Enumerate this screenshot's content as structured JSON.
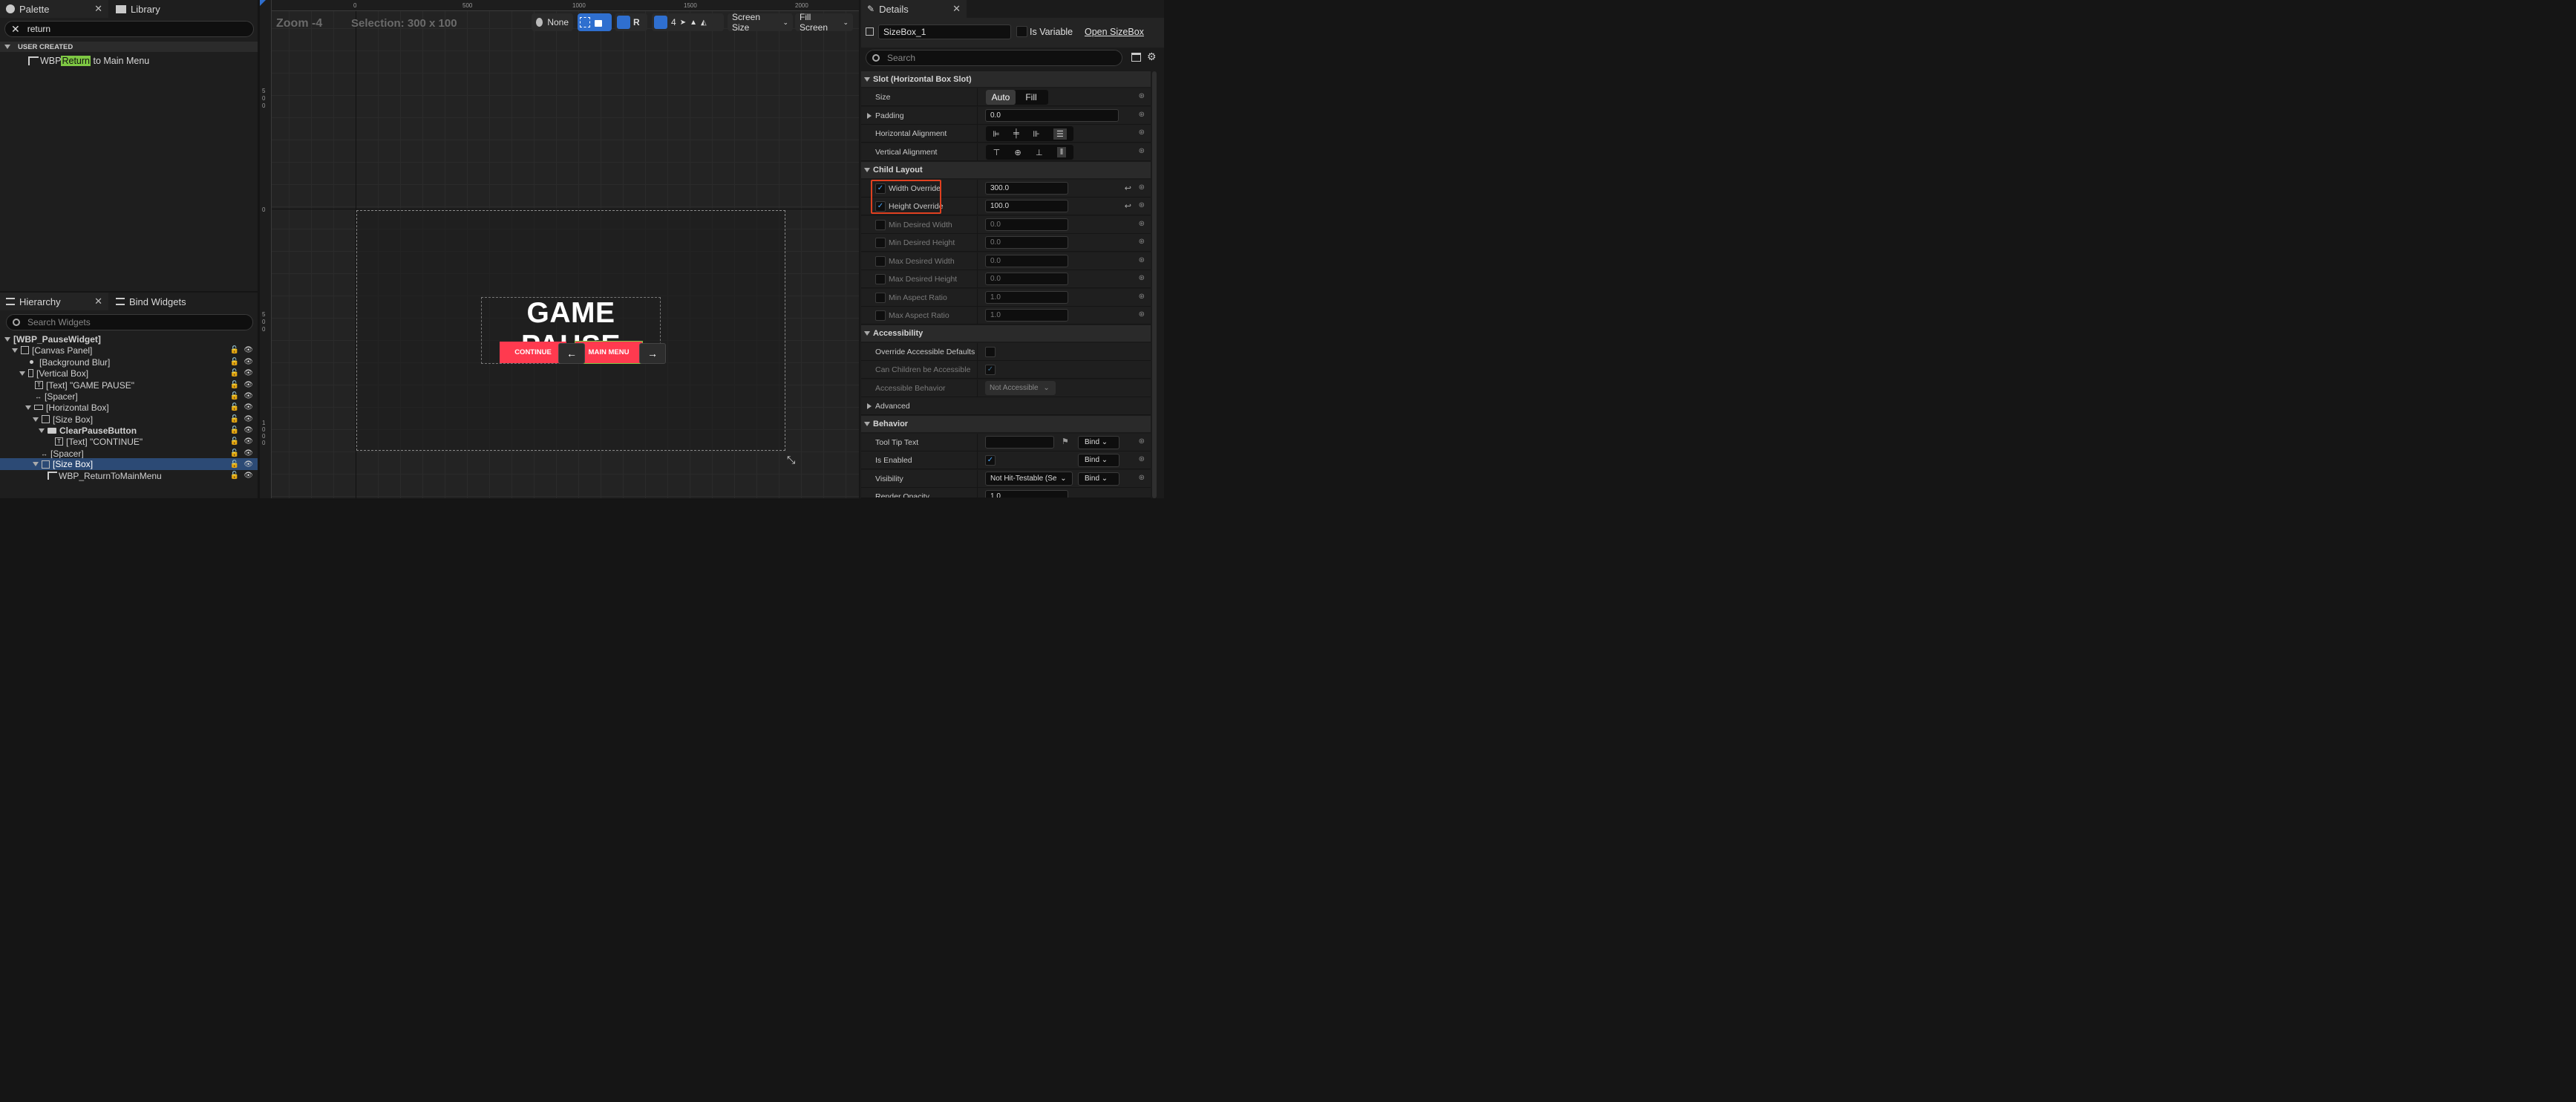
{
  "palette": {
    "tab_label": "Palette",
    "library_label": "Library",
    "search_value": "return",
    "category": "USER CREATED",
    "item_prefix": "WBP ",
    "item_highlight": "Return",
    "item_suffix": " to Main Menu"
  },
  "hierarchy": {
    "tab_label": "Hierarchy",
    "bind_label": "Bind Widgets",
    "search_placeholder": "Search Widgets",
    "root": "[WBP_PauseWidget]",
    "items": [
      {
        "label": "[Canvas Panel]",
        "icon": "canvas-icon"
      },
      {
        "label": "[Background Blur]",
        "icon": "dot-icon"
      },
      {
        "label": "[Vertical Box]",
        "icon": "vbox-icon"
      },
      {
        "label": "[Text] \"GAME PAUSE\"",
        "icon": "text-icon"
      },
      {
        "label": "[Spacer]",
        "icon": "spacer-icon"
      },
      {
        "label": "[Horizontal Box]",
        "icon": "hbox-icon"
      },
      {
        "label": "[Size Box]",
        "icon": "sizebox-icon"
      },
      {
        "label": "ClearPauseButton",
        "icon": "button-icon"
      },
      {
        "label": "[Text] \"CONTINUE\"",
        "icon": "text-icon"
      },
      {
        "label": "[Spacer]",
        "icon": "spacer-icon"
      },
      {
        "label": "[Size Box]",
        "icon": "sizebox-icon"
      },
      {
        "label": "WBP_ReturnToMainMenu",
        "icon": "widget-icon"
      }
    ]
  },
  "viewport": {
    "zoom": "Zoom -4",
    "selection": "Selection: 300 x 100",
    "ruler_top": [
      "0",
      "500",
      "1000",
      "1500",
      "2000"
    ],
    "ruler_left": [
      "500",
      "0",
      "500",
      "1000"
    ],
    "toolbar": {
      "none_label": "None",
      "r_label": "R",
      "grid_value": "4",
      "screen_size": "Screen Size",
      "fill_screen": "Fill Screen"
    },
    "title": "GAME PAUSE",
    "continue_label": "CONTINUE",
    "mainmenu_label": "MAIN MENU",
    "left_arrow": "←",
    "right_arrow": "→"
  },
  "details": {
    "tab_label": "Details",
    "name_value": "SizeBox_1",
    "is_variable": "Is Variable",
    "open_link": "Open SizeBox",
    "search_placeholder": "Search",
    "sec_slot": "Slot (Horizontal Box Slot)",
    "size_label": "Size",
    "size_auto": "Auto",
    "size_fill": "Fill",
    "padding_label": "Padding",
    "padding_value": "0.0",
    "halign_label": "Horizontal Alignment",
    "valign_label": "Vertical Alignment",
    "sec_child": "Child Layout",
    "width_override": "Width Override",
    "width_value": "300.0",
    "height_override": "Height Override",
    "height_value": "100.0",
    "min_w": "Min Desired Width",
    "min_w_val": "0.0",
    "min_h": "Min Desired Height",
    "min_h_val": "0.0",
    "max_w": "Max Desired Width",
    "max_w_val": "0.0",
    "max_h": "Max Desired Height",
    "max_h_val": "0.0",
    "min_ar": "Min Aspect Ratio",
    "min_ar_val": "1.0",
    "max_ar": "Max Aspect Ratio",
    "max_ar_val": "1.0",
    "sec_access": "Accessibility",
    "override_access": "Override Accessible Defaults",
    "can_children": "Can Children be Accessible",
    "access_behavior": "Accessible Behavior",
    "access_behavior_val": "Not Accessible",
    "advanced": "Advanced",
    "sec_behavior": "Behavior",
    "tooltip": "Tool Tip Text",
    "bind": "Bind",
    "is_enabled": "Is Enabled",
    "visibility": "Visibility",
    "visibility_val": "Not Hit-Testable (Se",
    "render_opacity": "Render Opacity",
    "render_opacity_val": "1.0"
  },
  "colors": {
    "accent_red": "#ff3a4f",
    "highlight_green": "#7ec843",
    "select_blue": "#2f6fcf"
  }
}
